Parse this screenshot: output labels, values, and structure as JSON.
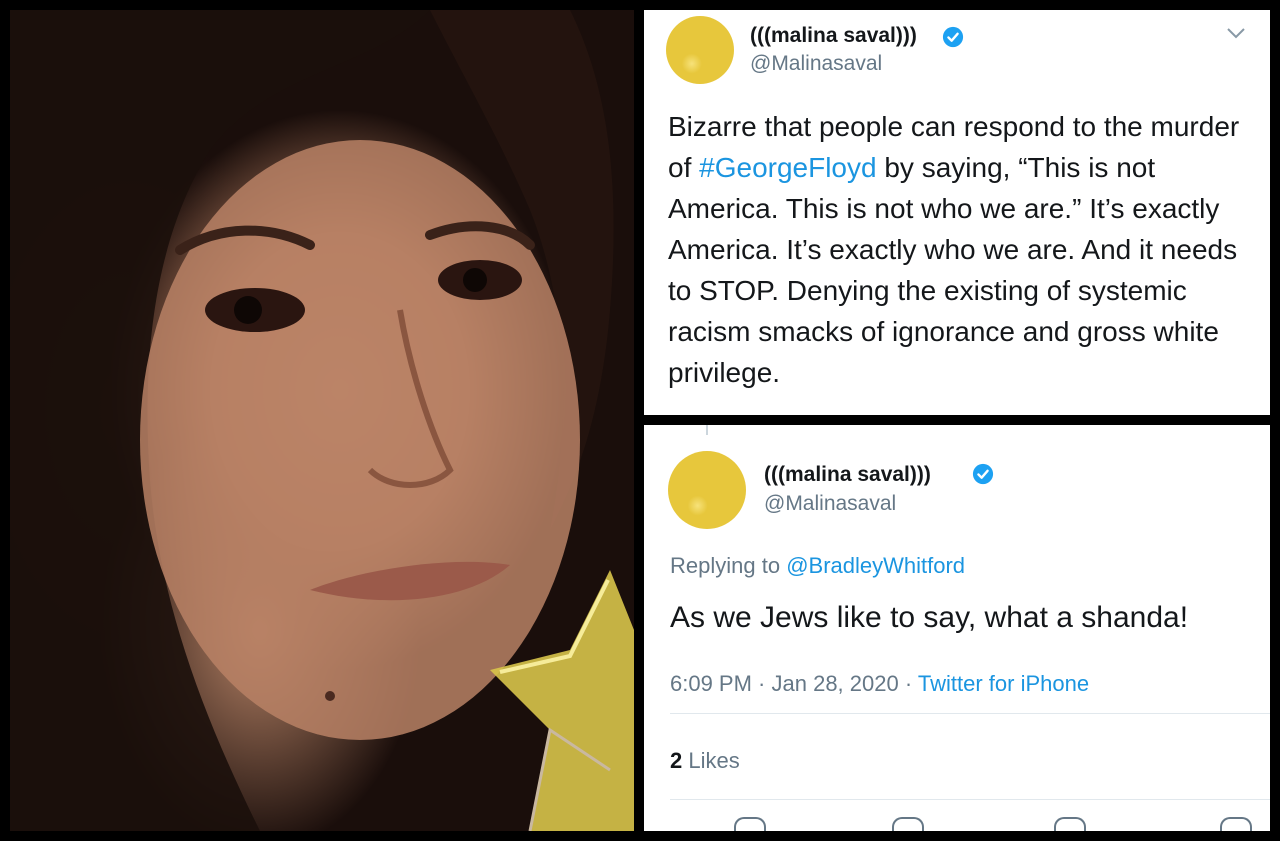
{
  "tweet1": {
    "display_name": "(((malina saval)))",
    "handle": "@Malinasaval",
    "text_before": "Bizarre that people can respond to the murder of ",
    "hashtag": "#GeorgeFloyd",
    "text_after": " by saying, “This is not America. This is not who we are.” It’s exactly America. It’s exactly who we are. And it needs to STOP. Denying the existing of systemic racism smacks of ignorance and gross white privilege.",
    "icons": [
      "verified-badge",
      "chevron-down-icon"
    ]
  },
  "tweet2": {
    "display_name": "(((malina saval)))",
    "handle": "@Malinasaval",
    "replying_prefix": "Replying to ",
    "replying_to": "@BradleyWhitford",
    "text": "As we Jews like to say, what a shanda!",
    "time": "6:09 PM",
    "separator1": " · ",
    "date": "Jan 28, 2020",
    "separator2": " · ",
    "source": "Twitter for iPhone",
    "likes_count": "2",
    "likes_label": "Likes",
    "icons": [
      "verified-badge",
      "reply-icon",
      "retweet-icon",
      "like-icon",
      "share-icon"
    ]
  },
  "colors": {
    "accent": "#1b95e0",
    "text": "#14171a",
    "secondary": "#657786",
    "background": "#000000"
  }
}
